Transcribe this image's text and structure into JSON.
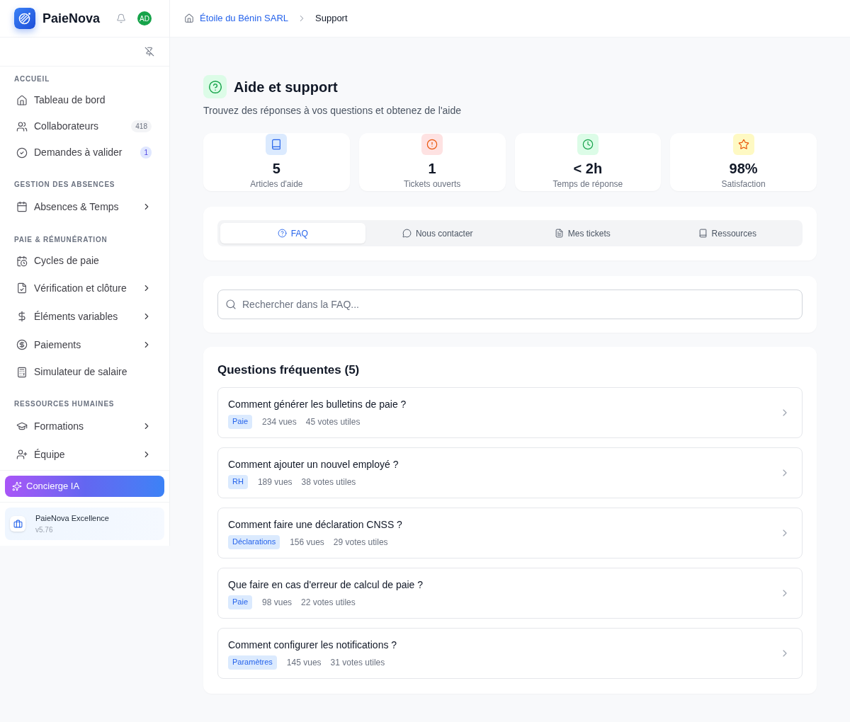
{
  "sidebar": {
    "brand": "PaieNova",
    "avatar": "AD",
    "sections": [
      {
        "title": "ACCUEIL",
        "items": [
          {
            "label": "Tableau de bord",
            "expandable": false
          },
          {
            "label": "Collaborateurs",
            "expandable": false,
            "badge": {
              "text": "418",
              "kind": "neutral"
            }
          },
          {
            "label": "Demandes à valider",
            "expandable": false,
            "badge": {
              "text": "1",
              "kind": "accent"
            }
          }
        ]
      },
      {
        "title": "GESTION DES ABSENCES",
        "items": [
          {
            "label": "Absences & Temps",
            "expandable": true
          }
        ]
      },
      {
        "title": "PAIE & RÉMUNÉRATION",
        "items": [
          {
            "label": "Cycles de paie",
            "expandable": false
          },
          {
            "label": "Vérification et clôture",
            "expandable": true
          },
          {
            "label": "Éléments variables",
            "expandable": true
          },
          {
            "label": "Paiements",
            "expandable": true
          },
          {
            "label": "Simulateur de salaire",
            "expandable": false
          }
        ]
      },
      {
        "title": "RESSOURCES HUMAINES",
        "items": [
          {
            "label": "Formations",
            "expandable": true
          },
          {
            "label": "Équipe",
            "expandable": true
          }
        ]
      }
    ],
    "assistant": {
      "label": "Concierge IA"
    },
    "plan": {
      "name": "PaieNova Excellence",
      "version": "v5.76"
    }
  },
  "breadcrumb": [
    {
      "label": "Étoile du Bénin SARL",
      "kind": "link"
    },
    {
      "label": "Support",
      "kind": "current"
    }
  ],
  "page": {
    "title": "Aide et support",
    "subtitle": "Trouvez des réponses à vos questions et obtenez de l'aide"
  },
  "stats": [
    {
      "value": "5",
      "label": "Articles d'aide",
      "color": "#dbeafe"
    },
    {
      "value": "1",
      "label": "Tickets ouverts",
      "color": "#fee2e2"
    },
    {
      "value": "< 2h",
      "label": "Temps de réponse",
      "color": "#dcfce7"
    },
    {
      "value": "98%",
      "label": "Satisfaction",
      "color": "#fef9c3"
    }
  ],
  "tabs": [
    {
      "label": "FAQ",
      "selected": true
    },
    {
      "label": "Nous contacter",
      "selected": false
    },
    {
      "label": "Mes tickets",
      "selected": false
    },
    {
      "label": "Ressources",
      "selected": false
    }
  ],
  "search": {
    "placeholder": "Rechercher dans la FAQ..."
  },
  "faq": {
    "title": "Questions fréquentes (5)",
    "items": [
      {
        "question": "Comment générer les bulletins de paie ?",
        "tag": "Paie",
        "views": "234 vues",
        "votes": "45 votes utiles"
      },
      {
        "question": "Comment ajouter un nouvel employé ?",
        "tag": "RH",
        "views": "189 vues",
        "votes": "38 votes utiles"
      },
      {
        "question": "Comment faire une déclaration CNSS ?",
        "tag": "Déclarations",
        "views": "156 vues",
        "votes": "29 votes utiles"
      },
      {
        "question": "Que faire en cas d'erreur de calcul de paie ?",
        "tag": "Paie",
        "views": "98 vues",
        "votes": "22 votes utiles"
      },
      {
        "question": "Comment configurer les notifications ?",
        "tag": "Paramètres",
        "views": "145 vues",
        "votes": "31 votes utiles"
      }
    ]
  }
}
